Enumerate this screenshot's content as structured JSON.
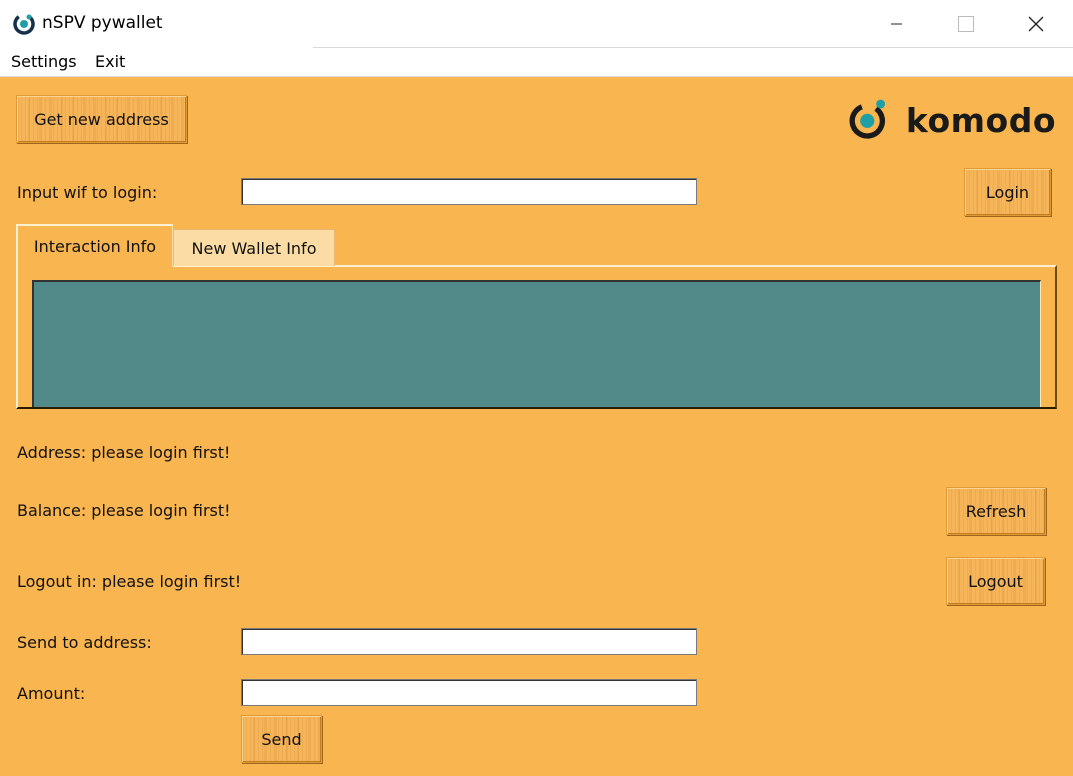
{
  "window": {
    "title": "nSPV pywallet",
    "icon": "komodo-logo-icon"
  },
  "menu": {
    "settings": "Settings",
    "exit": "Exit"
  },
  "buttons": {
    "get_new_address": "Get new address",
    "login": "Login",
    "refresh": "Refresh",
    "logout": "Logout",
    "send": "Send"
  },
  "logo": {
    "text": "komodo"
  },
  "form": {
    "wif_label": "Input wif to login:",
    "wif_value": "",
    "send_to_label": "Send to address:",
    "send_to_value": "",
    "amount_label": "Amount:",
    "amount_value": ""
  },
  "tabs": [
    {
      "label": "Interaction Info",
      "selected": true
    },
    {
      "label": "New Wallet Info",
      "selected": false
    }
  ],
  "info_text": "",
  "status": {
    "address": "Address: please login first!",
    "balance": "Balance: please login first!",
    "logout": "Logout in: please login first!"
  },
  "colors": {
    "background": "#f9b550",
    "info_panel": "#528a89",
    "brand_teal": "#1f9fa6",
    "brand_dark": "#1a1a1a"
  }
}
